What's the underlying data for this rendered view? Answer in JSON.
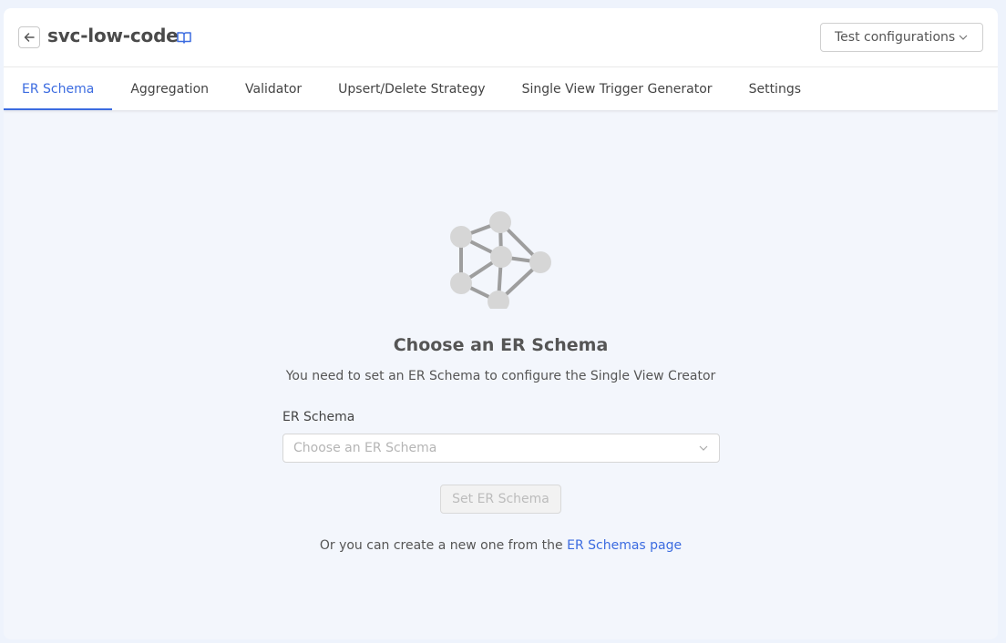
{
  "header": {
    "title": "svc-low-code",
    "test_button_label": "Test configurations"
  },
  "tabs": [
    {
      "label": "ER Schema",
      "active": true
    },
    {
      "label": "Aggregation",
      "active": false
    },
    {
      "label": "Validator",
      "active": false
    },
    {
      "label": "Upsert/Delete Strategy",
      "active": false
    },
    {
      "label": "Single View Trigger Generator",
      "active": false
    },
    {
      "label": "Settings",
      "active": false
    }
  ],
  "empty_state": {
    "icon": "graph-nodes-icon",
    "title": "Choose an ER Schema",
    "subtitle": "You need to set an ER Schema to configure the Single View Creator"
  },
  "form": {
    "label": "ER Schema",
    "select_placeholder": "Choose an ER Schema",
    "submit_label": "Set ER Schema",
    "submit_disabled": true
  },
  "footer": {
    "text": "Or you can create a new one from the ",
    "link_label": "ER Schemas page"
  },
  "colors": {
    "accent": "#3b6be0",
    "page_background": "#f3f6fc",
    "icon_gray": "#9e9e9e",
    "node_gray": "#d6d6d6"
  }
}
